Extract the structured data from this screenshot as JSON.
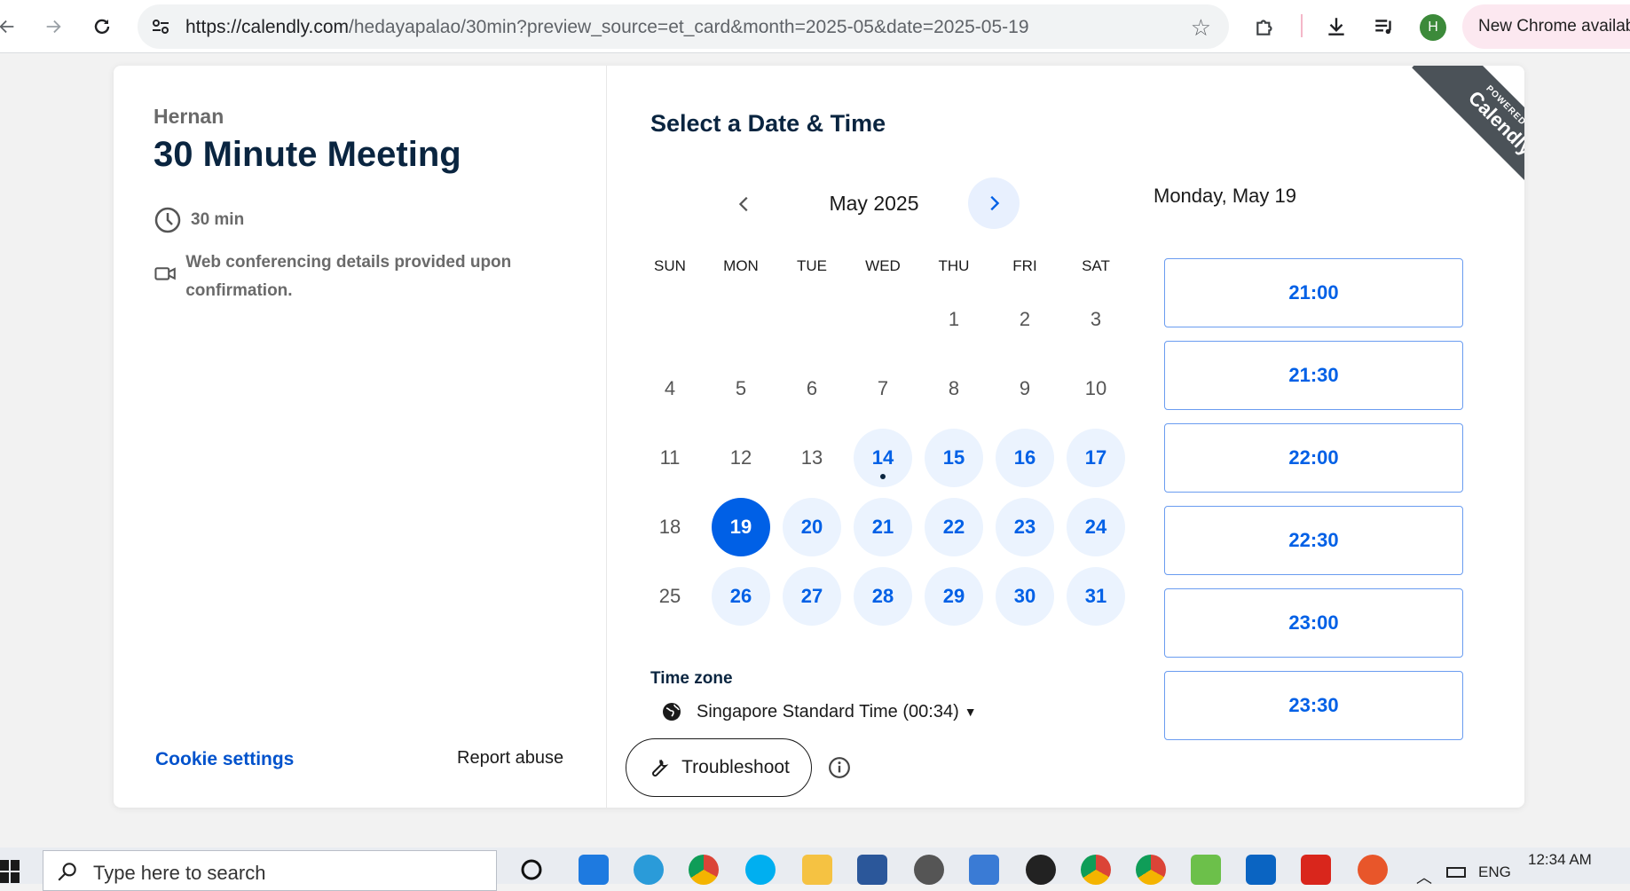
{
  "browser": {
    "url_host": "https://calendly.com",
    "url_path": "/hedayapalao/30min?preview_source=et_card&month=2025-05&date=2025-05-19",
    "profile_initial": "H",
    "update_label": "New Chrome available"
  },
  "event": {
    "host": "Hernan",
    "title": "30 Minute Meeting",
    "duration": "30 min",
    "location": "Web conferencing details provided upon confirmation.",
    "cookie_settings": "Cookie settings",
    "report_abuse": "Report abuse"
  },
  "scheduler": {
    "heading": "Select a Date & Time",
    "month": "May 2025",
    "weekdays": [
      "SUN",
      "MON",
      "TUE",
      "WED",
      "THU",
      "FRI",
      "SAT"
    ],
    "days": [
      {
        "n": "1",
        "state": "unavailable"
      },
      {
        "n": "2",
        "state": "unavailable"
      },
      {
        "n": "3",
        "state": "unavailable"
      },
      {
        "n": "4",
        "state": "unavailable"
      },
      {
        "n": "5",
        "state": "unavailable"
      },
      {
        "n": "6",
        "state": "unavailable"
      },
      {
        "n": "7",
        "state": "unavailable"
      },
      {
        "n": "8",
        "state": "unavailable"
      },
      {
        "n": "9",
        "state": "unavailable"
      },
      {
        "n": "10",
        "state": "unavailable"
      },
      {
        "n": "11",
        "state": "unavailable"
      },
      {
        "n": "12",
        "state": "unavailable"
      },
      {
        "n": "13",
        "state": "unavailable"
      },
      {
        "n": "14",
        "state": "available",
        "today": true
      },
      {
        "n": "15",
        "state": "available"
      },
      {
        "n": "16",
        "state": "available"
      },
      {
        "n": "17",
        "state": "available"
      },
      {
        "n": "18",
        "state": "unavailable"
      },
      {
        "n": "19",
        "state": "selected"
      },
      {
        "n": "20",
        "state": "available"
      },
      {
        "n": "21",
        "state": "available"
      },
      {
        "n": "22",
        "state": "available"
      },
      {
        "n": "23",
        "state": "available"
      },
      {
        "n": "24",
        "state": "available"
      },
      {
        "n": "25",
        "state": "unavailable"
      },
      {
        "n": "26",
        "state": "available"
      },
      {
        "n": "27",
        "state": "available"
      },
      {
        "n": "28",
        "state": "available"
      },
      {
        "n": "29",
        "state": "available"
      },
      {
        "n": "30",
        "state": "available"
      },
      {
        "n": "31",
        "state": "available"
      }
    ],
    "first_weekday_index": 4,
    "timezone_label": "Time zone",
    "timezone": "Singapore Standard Time (00:34)",
    "troubleshoot": "Troubleshoot",
    "selected_date": "Monday, May 19",
    "slots": [
      "21:00",
      "21:30",
      "22:00",
      "22:30",
      "23:00",
      "23:30"
    ],
    "badge_small": "POWERED BY",
    "badge_big": "Calendly"
  },
  "taskbar": {
    "search_placeholder": "Type here to search",
    "language": "ENG",
    "time": "12:34 AM"
  },
  "colors": {
    "accent": "#0060e6",
    "available_bg": "#ebf3fe",
    "title": "#0a2540"
  }
}
